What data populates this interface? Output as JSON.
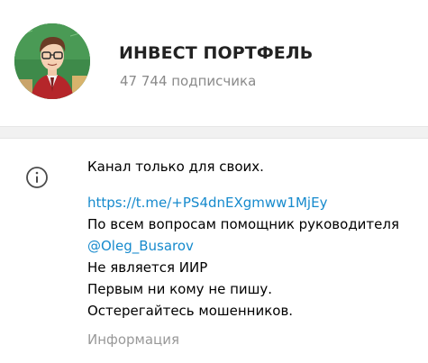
{
  "channel": {
    "title": "ИНВЕСТ ПОРТФЕЛЬ",
    "subscribers": "47 744 подписчика"
  },
  "about": {
    "line1": "Канал только для своих.",
    "invite_link": "https://t.me/+PS4dnEXgmww1MjEy",
    "line3": "По всем вопросам помощник руководителя",
    "mention": "@Oleg_Busarov",
    "line5": "Не является ИИР",
    "line6": "Первым ни кому не пишу.",
    "line7": "Остерегайтесь мошенников.",
    "label": "Информация"
  },
  "colors": {
    "link": "#168acd",
    "muted": "#999999",
    "divider": "#f1f1f1"
  },
  "icons": {
    "info": "info-icon",
    "avatar": "channel-avatar"
  }
}
